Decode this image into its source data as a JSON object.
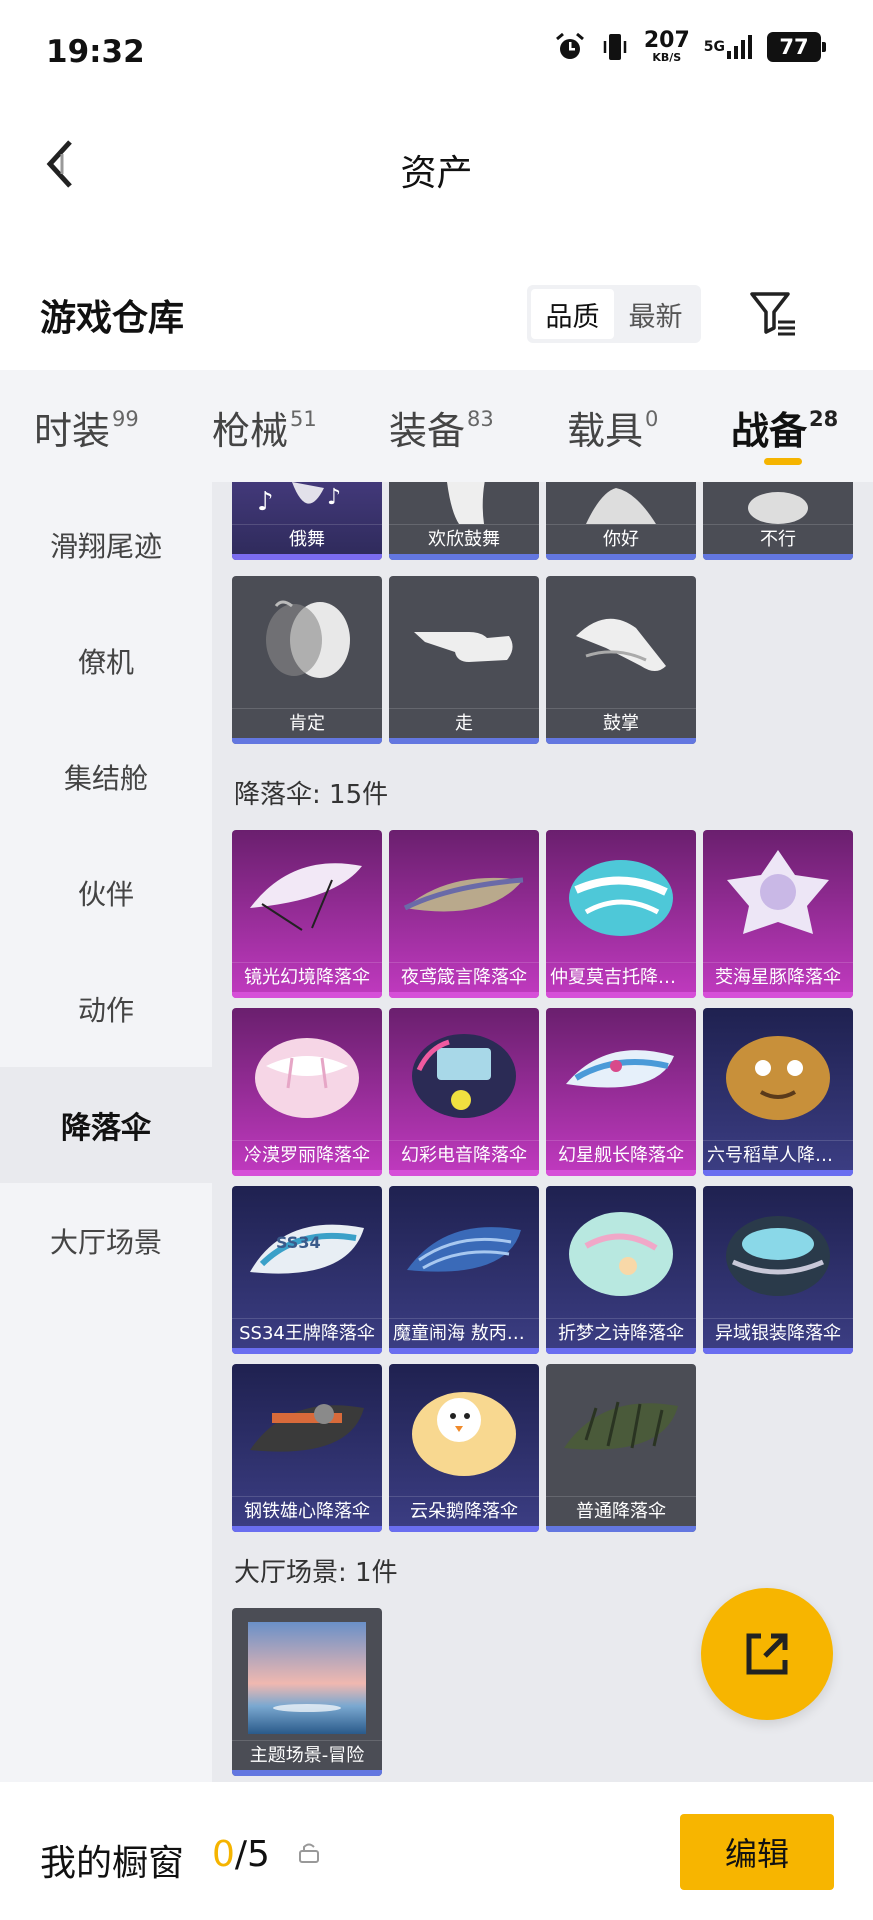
{
  "status_bar": {
    "time": "19:32",
    "speed_value": "207",
    "speed_unit": "KB/S",
    "network": "5G",
    "battery": "77"
  },
  "nav": {
    "title": "资产"
  },
  "warehouse": {
    "title": "游戏仓库",
    "sort_options": [
      "品质",
      "最新"
    ],
    "sort_selected": "品质"
  },
  "tabs": [
    {
      "label": "时装",
      "count": "99"
    },
    {
      "label": "枪械",
      "count": "51"
    },
    {
      "label": "装备",
      "count": "83"
    },
    {
      "label": "载具",
      "count": "0"
    },
    {
      "label": "战备",
      "count": "28",
      "active": true
    }
  ],
  "sidebar": {
    "items": [
      "滑翔尾迹",
      "僚机",
      "集结舱",
      "伙伴",
      "动作",
      "降落伞",
      "大厅场景"
    ],
    "active": "降落伞"
  },
  "actions": {
    "row1": [
      "俄舞",
      "欢欣鼓舞",
      "你好",
      "不行"
    ],
    "row2": [
      "肯定",
      "走",
      "鼓掌"
    ]
  },
  "parachutes": {
    "header": "降落伞: 15件",
    "items": [
      "镜光幻境降落伞",
      "夜鸢箴言降落伞",
      "仲夏莫吉托降落伞",
      "茭海星豚降落伞",
      "冷漠罗丽降落伞",
      "幻彩电音降落伞",
      "幻星舰长降落伞",
      "六号稻草人降落伞",
      "SS34王牌降落伞",
      "魔童闹海 敖丙降落伞",
      "折梦之诗降落伞",
      "异域银装降落伞",
      "钢铁雄心降落伞",
      "云朵鹅降落伞",
      "普通降落伞"
    ]
  },
  "lobby": {
    "header": "大厅场景: 1件",
    "items": [
      "主题场景-冒险"
    ]
  },
  "bottom": {
    "showcase_label": "我的橱窗",
    "current": "0",
    "total": "/5",
    "edit_label": "编辑"
  },
  "colors": {
    "accent": "#f7b500",
    "pink_rarity": "#c13ac0",
    "navy_rarity": "#3c3e84",
    "gray_rarity": "#4b4d55"
  }
}
